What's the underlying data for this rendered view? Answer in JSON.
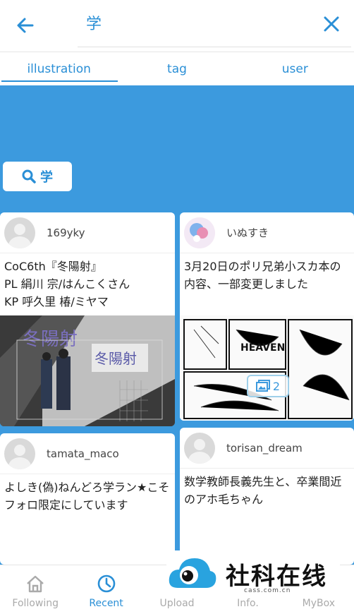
{
  "search": {
    "query": "学"
  },
  "tabs": [
    {
      "label": "illustration",
      "active": true
    },
    {
      "label": "tag",
      "active": false
    },
    {
      "label": "user",
      "active": false
    }
  ],
  "tag_chip": {
    "label": "学"
  },
  "cards": [
    {
      "username": "169yky",
      "title": "CoC6th『冬陽射』\nPL 絹川 宗/はんこくさん\nKP 呼久里 椿/ミヤマ",
      "art_text": "冬陽射"
    },
    {
      "username": "いぬすき",
      "title": "3月20日のポリ兄弟小スカ本の内容、一部変更しました",
      "page_count": "2"
    },
    {
      "username": "tamata_maco",
      "title": "よしき(偽)ねんどろ学ラン★こそフォロ限定にしています"
    },
    {
      "username": "torisan_dream",
      "title": "数学教師長義先生と、卒業間近のアホ毛ちゃん"
    }
  ],
  "nav": [
    {
      "label": "Following",
      "icon": "home-icon",
      "active": false
    },
    {
      "label": "Recent",
      "icon": "clock-icon",
      "active": true
    },
    {
      "label": "Upload",
      "icon": "upload-icon",
      "active": false
    },
    {
      "label": "Info.",
      "icon": "info-icon",
      "active": false
    },
    {
      "label": "MyBox",
      "icon": "box-icon",
      "active": false
    }
  ],
  "watermark": {
    "title": "社科在线",
    "sub": "cass.com.cn"
  },
  "colors": {
    "accent": "#2a8fd6",
    "panel": "#3c9ade"
  }
}
